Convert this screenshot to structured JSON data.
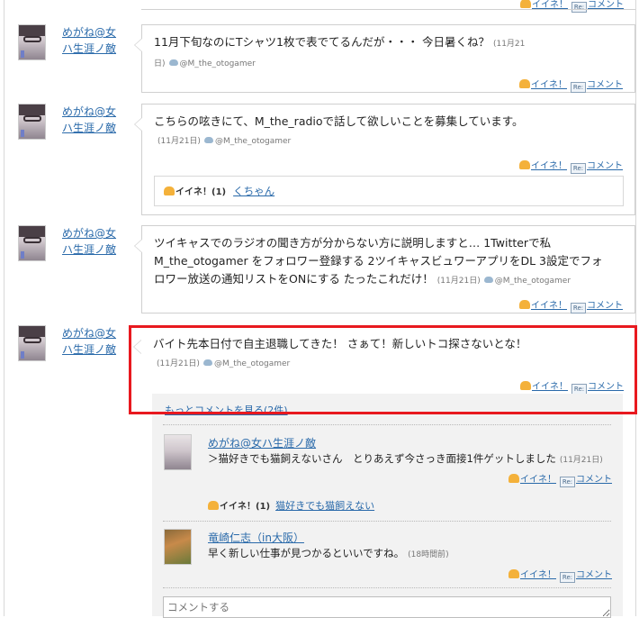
{
  "actions": {
    "like": "イイネ！",
    "comment": "コメント",
    "re_badge": "Re:"
  },
  "posts": [
    {
      "user": "めがね@女ハ生涯ノ敵",
      "text": "11月下旬なのにTシャツ1枚で表でてるんだが・・・ 今日暑くね？",
      "date": "(11月21日)",
      "handle": "@M_the_otogamer"
    },
    {
      "user": "めがね@女ハ生涯ノ敵",
      "text": "こちらの呟きにて、M_the_radioで話して欲しいことを募集しています。",
      "date": "(11月21日)",
      "handle": "@M_the_otogamer",
      "likes": {
        "label": "イイネ！(1)",
        "name": "くちゃん"
      }
    },
    {
      "user": "めがね@女ハ生涯ノ敵",
      "text": "ツイキャスでのラジオの聞き方が分からない方に説明しますと… 1Twitterで私M_the_otogamer をフォロワー登録する 2ツイキャスビュワーアプリをDL 3設定でフォロワー放送の通知リストをONにする たったこれだけ！",
      "date": "(11月21日)",
      "handle": "@M_the_otogamer"
    },
    {
      "user": "めがね@女ハ生涯ノ敵",
      "text": "バイト先本日付で自主退職してきた！ さぁて！新しいトコ探さないとな！",
      "date": "(11月21日)",
      "handle": "@M_the_otogamer"
    }
  ],
  "thread": {
    "more_link": "もっとコメントを見る(2件)",
    "comments": [
      {
        "user": "めがね@女ハ生涯ノ敵",
        "text": "＞猫好きでも猫飼えないさん　とりあえず今さっき面接1件ゲットしました",
        "date": "(11月21日)",
        "likes": {
          "label": "イイネ！(1)",
          "name": "猫好きでも猫飼えない"
        }
      },
      {
        "user": "竜崎仁志（in大阪）",
        "text": "早く新しい仕事が見つかるといいですね。",
        "date": "(18時間前)"
      }
    ],
    "input_placeholder": "コメントする"
  },
  "colors": {
    "link": "#2a6aaa",
    "highlight": "#e8191f",
    "like_icon": "#f4b13a"
  }
}
